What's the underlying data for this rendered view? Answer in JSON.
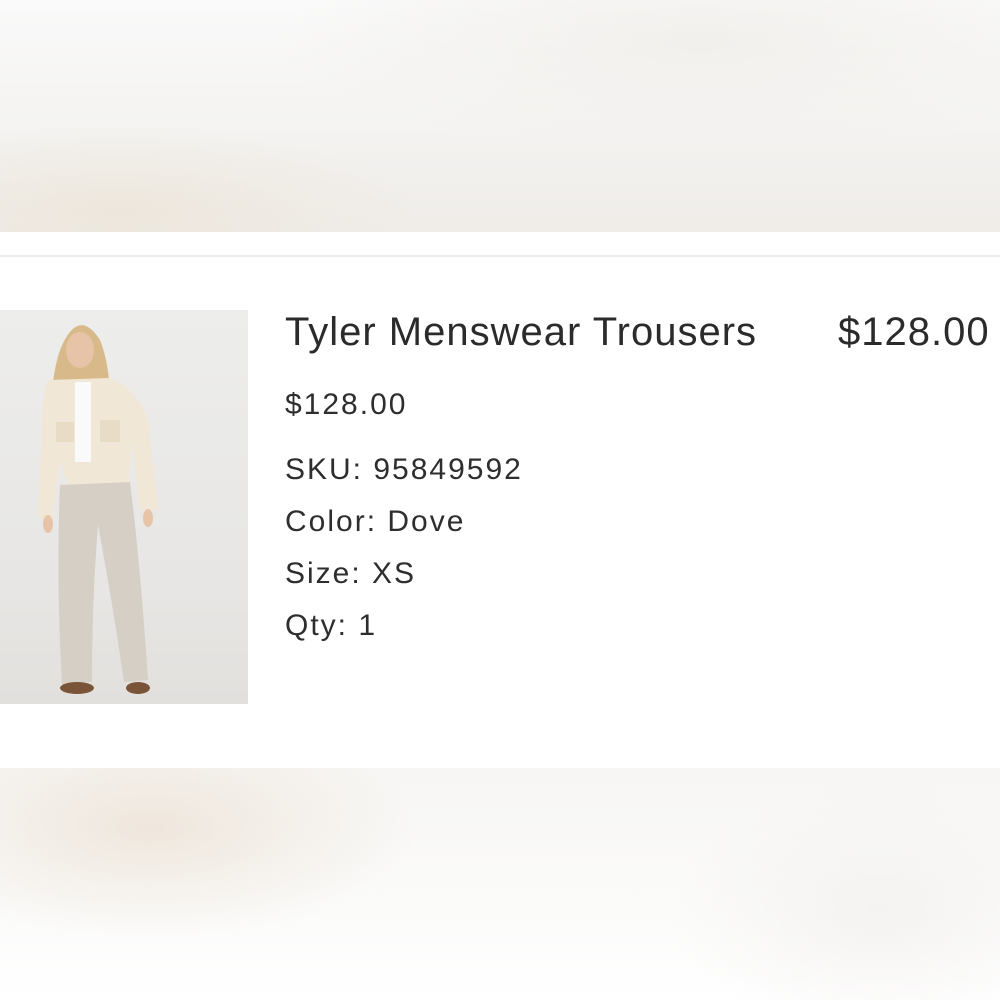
{
  "item": {
    "title": "Tyler Menswear Trousers",
    "line_price": "$128.00",
    "unit_price": "$128.00",
    "sku_label": "SKU:",
    "sku_value": "95849592",
    "color_label": "Color:",
    "color_value": "Dove",
    "size_label": "Size:",
    "size_value": "XS",
    "qty_label": "Qty:",
    "qty_value": "1",
    "image_icon": "product-photo"
  }
}
